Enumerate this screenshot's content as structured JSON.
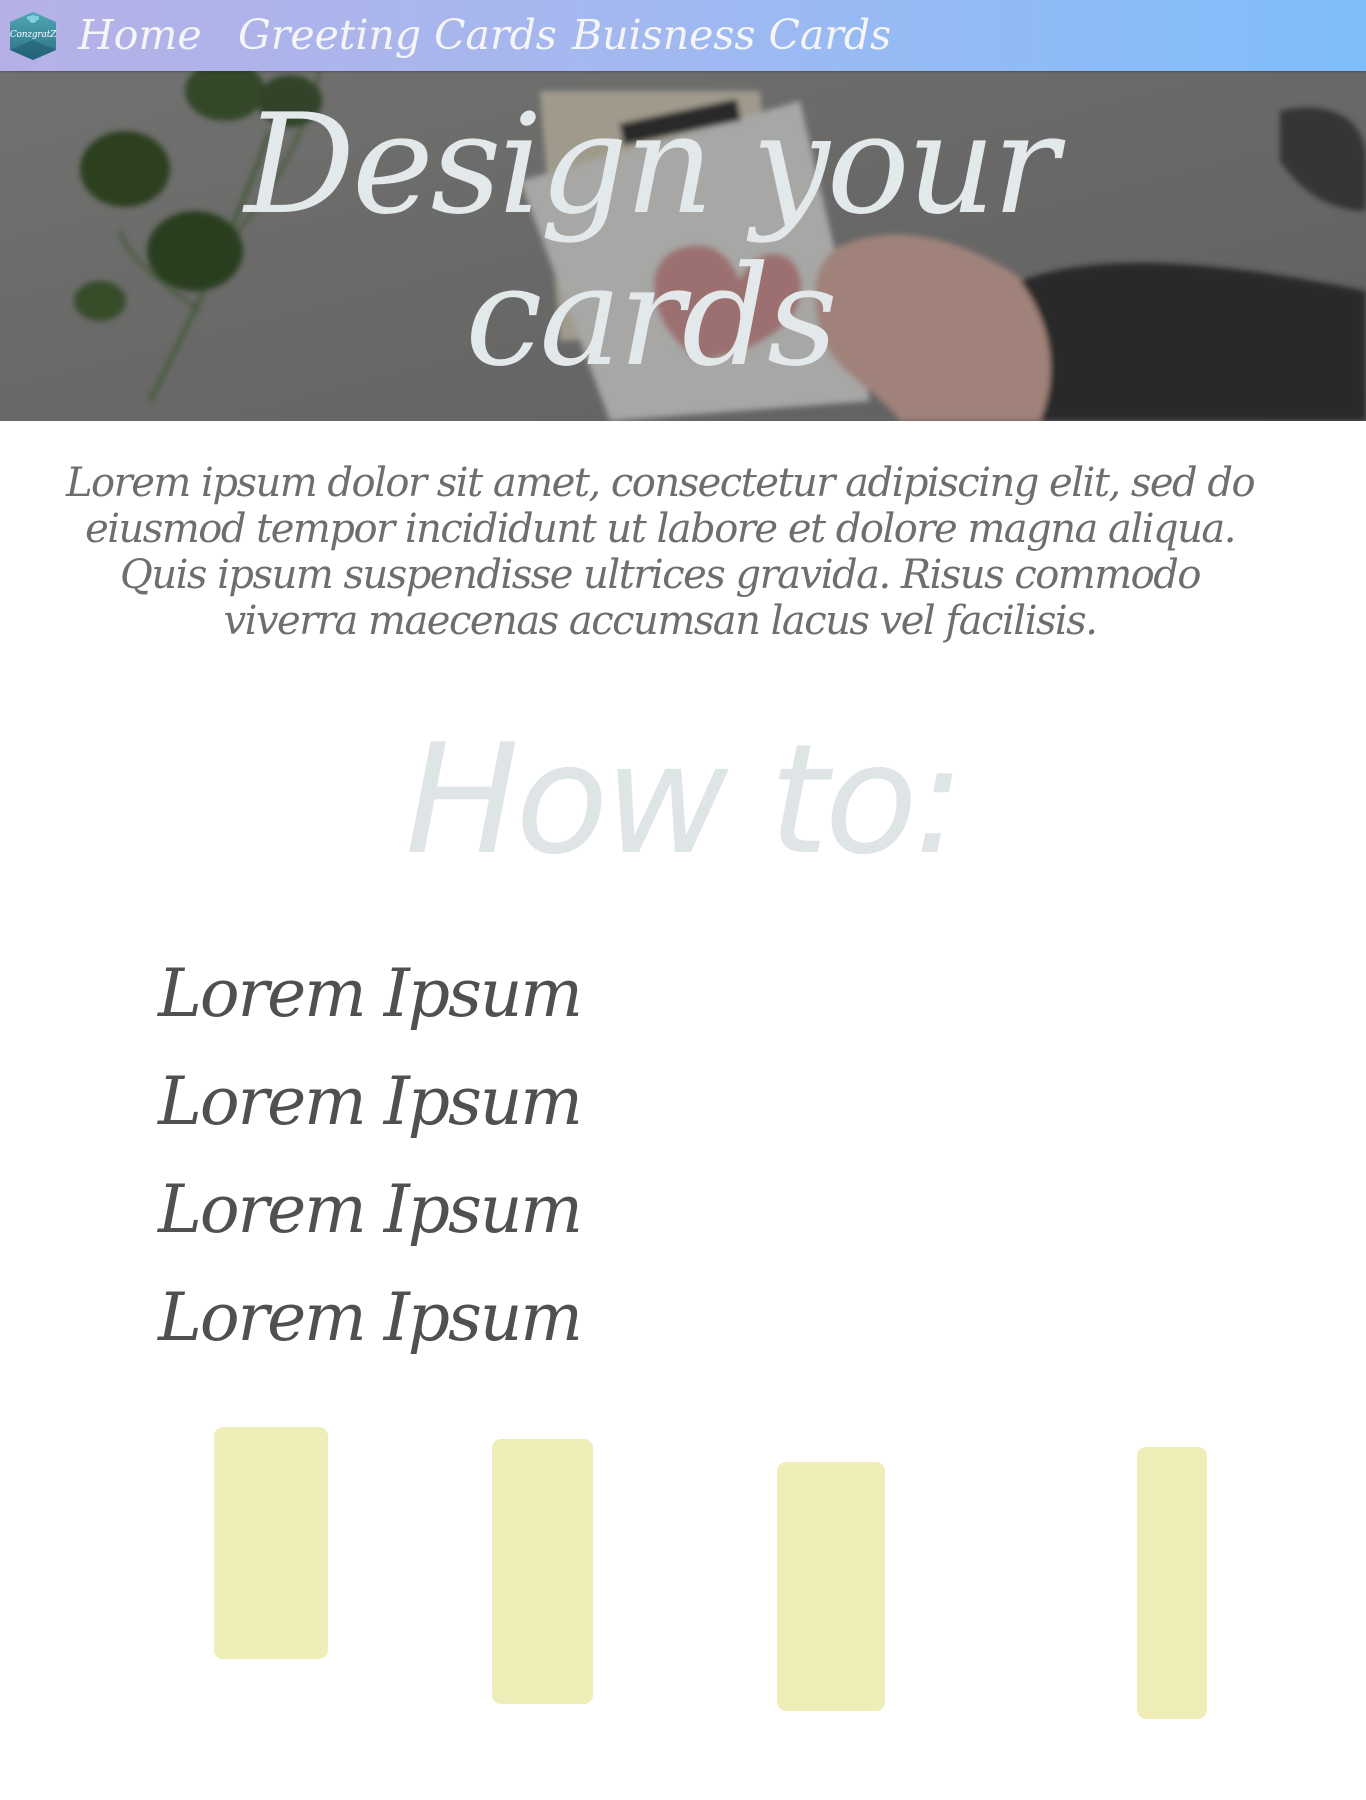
{
  "nav": {
    "logo_text": "ConzgratZ",
    "links": [
      {
        "label": "Home"
      },
      {
        "label": "Greeting Cards"
      },
      {
        "label": "Buisness Cards"
      }
    ]
  },
  "hero": {
    "title": "Design your cards"
  },
  "intro": {
    "text": "Lorem ipsum dolor sit amet, consectetur adipiscing elit, sed do eiusmod tempor incididunt ut labore et dolore magna aliqua. Quis ipsum suspendisse ultrices gravida. Risus commodo viverra maecenas accumsan lacus vel facilisis."
  },
  "howto": {
    "title": "How to:",
    "steps": [
      {
        "label": "Lorem Ipsum"
      },
      {
        "label": "Lorem Ipsum"
      },
      {
        "label": "Lorem Ipsum"
      },
      {
        "label": "Lorem Ipsum"
      }
    ]
  },
  "colors": {
    "nav_gradient_start": "#b5b1e6",
    "nav_gradient_end": "#7fbdfb",
    "card_placeholder": "#efeeb8",
    "howto_title": "#dfe5e7"
  }
}
